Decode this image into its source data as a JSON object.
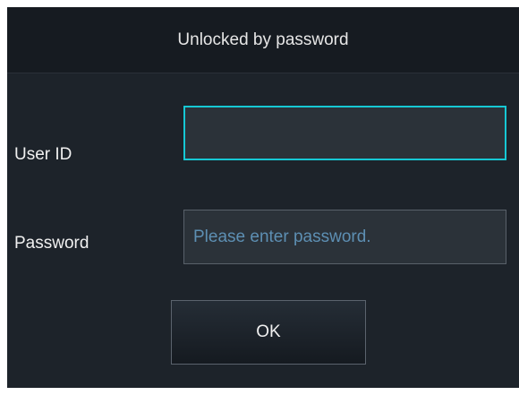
{
  "dialog": {
    "title": "Unlocked by password"
  },
  "form": {
    "user_id_label": "User ID",
    "user_id_value": "",
    "password_label": "Password",
    "password_placeholder": "Please enter password.",
    "password_value": "",
    "ok_label": "OK"
  },
  "colors": {
    "background": "#1d232a",
    "header": "#161b21",
    "focus_border": "#16c8d4",
    "placeholder": "#5d8fb3"
  }
}
